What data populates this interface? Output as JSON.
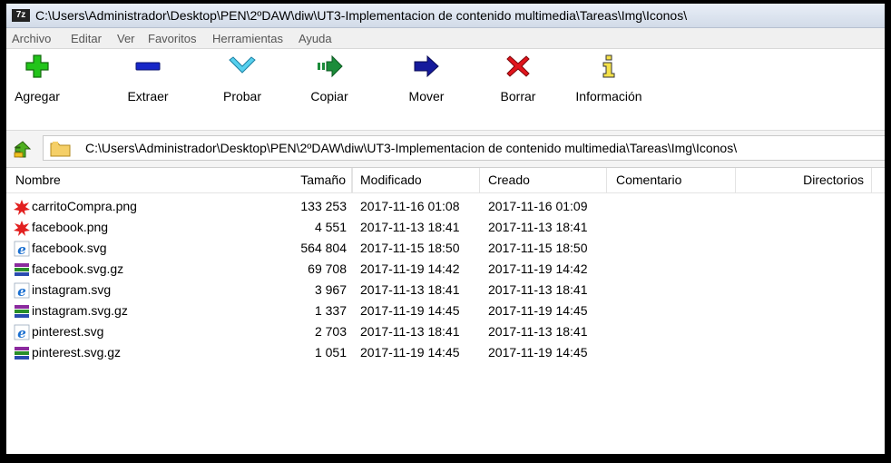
{
  "window": {
    "title": "C:\\Users\\Administrador\\Desktop\\PEN\\2ºDAW\\diw\\UT3-Implementacion de contenido multimedia\\Tareas\\Img\\Iconos\\",
    "app_icon_text": "7z"
  },
  "menu": [
    "Archivo",
    "Editar",
    "Ver",
    "Favoritos",
    "Herramientas",
    "Ayuda"
  ],
  "toolbar": {
    "add": "Agregar",
    "extract": "Extraer",
    "test": "Probar",
    "copy": "Copiar",
    "move": "Mover",
    "delete": "Borrar",
    "info": "Información"
  },
  "address": {
    "path": "C:\\Users\\Administrador\\Desktop\\PEN\\2ºDAW\\diw\\UT3-Implementacion de contenido multimedia\\Tareas\\Img\\Iconos\\"
  },
  "columns": {
    "name": "Nombre",
    "size": "Tamaño",
    "modified": "Modificado",
    "created": "Creado",
    "comment": "Comentario",
    "folders": "Directorios"
  },
  "files": [
    {
      "name": "carritoCompra.png",
      "size": "133 253",
      "modified": "2017-11-16 01:08",
      "created": "2017-11-16 01:09",
      "icon": "png-image-icon"
    },
    {
      "name": "facebook.png",
      "size": "4 551",
      "modified": "2017-11-13 18:41",
      "created": "2017-11-13 18:41",
      "icon": "png-image-icon"
    },
    {
      "name": "facebook.svg",
      "size": "564 804",
      "modified": "2017-11-15 18:50",
      "created": "2017-11-15 18:50",
      "icon": "internet-explorer-icon"
    },
    {
      "name": "facebook.svg.gz",
      "size": "69 708",
      "modified": "2017-11-19 14:42",
      "created": "2017-11-19 14:42",
      "icon": "winrar-archive-icon"
    },
    {
      "name": "instagram.svg",
      "size": "3 967",
      "modified": "2017-11-13 18:41",
      "created": "2017-11-13 18:41",
      "icon": "internet-explorer-icon"
    },
    {
      "name": "instagram.svg.gz",
      "size": "1 337",
      "modified": "2017-11-19 14:45",
      "created": "2017-11-19 14:45",
      "icon": "winrar-archive-icon"
    },
    {
      "name": "pinterest.svg",
      "size": "2 703",
      "modified": "2017-11-13 18:41",
      "created": "2017-11-13 18:41",
      "icon": "internet-explorer-icon"
    },
    {
      "name": "pinterest.svg.gz",
      "size": "1 051",
      "modified": "2017-11-19 14:45",
      "created": "2017-11-19 14:45",
      "icon": "winrar-archive-icon"
    }
  ]
}
